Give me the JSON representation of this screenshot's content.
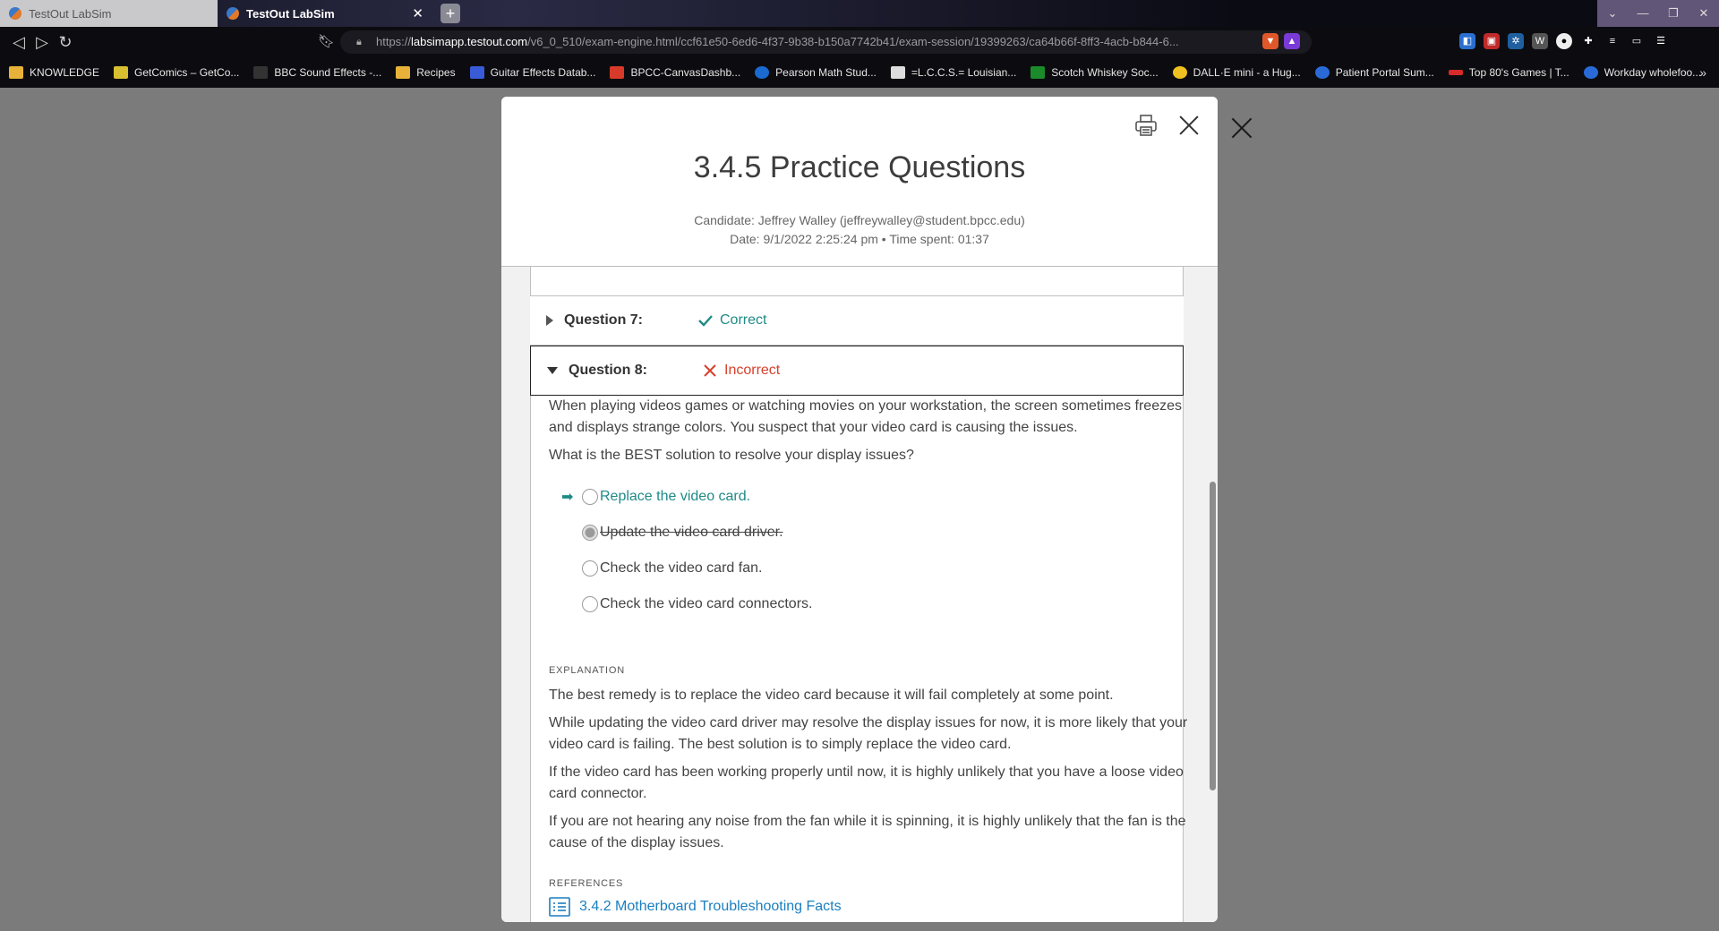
{
  "browser": {
    "tabs": [
      {
        "title": "TestOut LabSim",
        "active": false
      },
      {
        "title": "TestOut LabSim",
        "active": true
      }
    ],
    "new_tab": "+",
    "url_prefix": "https://",
    "url_host": "labsimapp.testout.com",
    "url_path": "/v6_0_510/exam-engine.html/ccf61e50-6ed6-4f37-9b38-b150a7742b41/exam-session/19399263/ca64b66f-8ff3-4acb-b844-6...",
    "bookmarks": [
      "KNOWLEDGE",
      "GetComics – GetCo...",
      "BBC Sound Effects -...",
      "Recipes",
      "Guitar Effects Datab...",
      "BPCC-CanvasDashb...",
      "Pearson Math Stud...",
      "=L.C.C.S.= Louisian...",
      "Scotch Whiskey Soc...",
      "DALL·E mini - a Hug...",
      "Patient Portal Sum...",
      "Top 80's Games | T...",
      "Workday wholefoo..."
    ],
    "bookmarks_more": "»"
  },
  "modal": {
    "title": "3.4.5 Practice Questions",
    "candidate": "Candidate: Jeffrey Walley  (jeffreywalley@student.bpcc.edu)",
    "date_line": "Date: 9/1/2022 2:25:24 pm • Time spent: 01:37"
  },
  "questions": {
    "q7": {
      "label": "Question 7:",
      "status": "Correct"
    },
    "q8": {
      "label": "Question 8:",
      "status": "Incorrect",
      "stem": "When playing videos games or watching movies on your workstation, the screen sometimes freezes and displays strange colors. You suspect that your video card is causing the issues.",
      "prompt": "What is the BEST solution to resolve your display issues?",
      "options": [
        {
          "text": "Replace the video card.",
          "correct": true
        },
        {
          "text": "Update the video card driver.",
          "selected": true
        },
        {
          "text": "Check the video card fan."
        },
        {
          "text": "Check the video card connectors."
        }
      ],
      "explanation_heading": "EXPLANATION",
      "explanation": [
        "The best remedy is to replace the video card because it will fail completely at some point.",
        "While updating the video card driver may resolve the display issues for now, it is more likely that your video card is failing. The best solution is to simply replace the video card.",
        "If the video card has been working properly until now, it is highly unlikely that you have a loose video card connector.",
        "If you are not hearing any noise from the fan while it is spinning, it is highly unlikely that the fan is the cause of the display issues."
      ],
      "references_heading": "REFERENCES",
      "reference_link": "3.4.2 Motherboard Troubleshooting Facts"
    }
  },
  "colors": {
    "correct": "#1f8a86",
    "incorrect": "#d6402c",
    "link": "#1a7fbf"
  }
}
